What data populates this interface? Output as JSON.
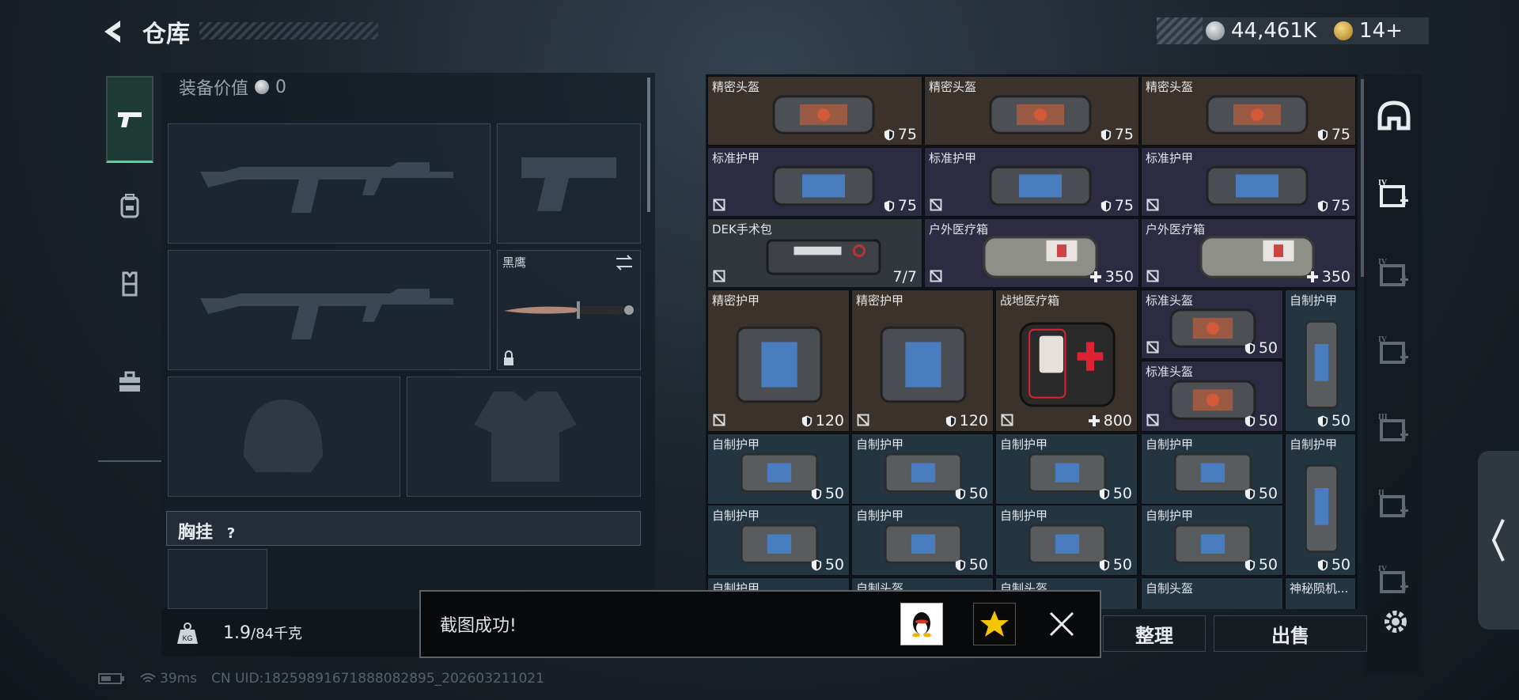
{
  "header": {
    "title": "仓库",
    "currency_silver": "44,461K",
    "currency_gold": "14+"
  },
  "equipment": {
    "value_label": "装备价值",
    "value": "0",
    "melee_name": "黑鹰",
    "chest_label": "胸挂",
    "chest_help": "?"
  },
  "footer": {
    "weight_current": "1.9",
    "weight_max": "/84千克",
    "sort_label": "整理",
    "sell_label": "出售",
    "ping": "39ms",
    "uid": "CN UID:1825989167188808289​5_202603211021"
  },
  "toast": {
    "message": "截图成功!"
  },
  "inventory": [
    {
      "name": "精密头盔",
      "value": "75",
      "kind": "shield",
      "color": "brown",
      "img": "helmet-red"
    },
    {
      "name": "精密头盔",
      "value": "75",
      "kind": "shield",
      "color": "brown",
      "img": "helmet-red"
    },
    {
      "name": "精密头盔",
      "value": "75",
      "kind": "shield",
      "color": "brown",
      "img": "helmet-red"
    },
    {
      "name": "标准护甲",
      "value": "75",
      "kind": "shield",
      "color": "purple",
      "img": "armor-blue"
    },
    {
      "name": "标准护甲",
      "value": "75",
      "kind": "shield",
      "color": "purple",
      "img": "armor-blue"
    },
    {
      "name": "标准护甲",
      "value": "75",
      "kind": "shield",
      "color": "purple",
      "img": "armor-blue"
    },
    {
      "name": "DEK手术包",
      "value": "7/7",
      "kind": "none",
      "color": "grey",
      "img": "surgery-kit"
    },
    {
      "name": "户外医疗箱",
      "value": "350",
      "kind": "plus",
      "color": "purple",
      "img": "med-box"
    },
    {
      "name": "户外医疗箱",
      "value": "350",
      "kind": "plus",
      "color": "purple",
      "img": "med-box"
    },
    {
      "name": "精密护甲",
      "value": "120",
      "kind": "shield",
      "color": "brown",
      "img": "armor-blue-big"
    },
    {
      "name": "精密护甲",
      "value": "120",
      "kind": "shield",
      "color": "brown",
      "img": "armor-blue-big"
    },
    {
      "name": "战地医疗箱",
      "value": "800",
      "kind": "plus",
      "color": "brown",
      "img": "first-aid"
    },
    {
      "name": "标准头盔",
      "value": "50",
      "kind": "shield",
      "color": "purple",
      "img": "helmet-red"
    },
    {
      "name": "标准头盔",
      "value": "50",
      "kind": "shield",
      "color": "purple",
      "img": "helmet-red"
    },
    {
      "name": "自制护甲",
      "value": "50",
      "kind": "shield",
      "color": "blue",
      "img": "vest"
    },
    {
      "name": "自制护甲",
      "value": "50",
      "kind": "shield",
      "color": "blue",
      "img": "pouch"
    },
    {
      "name": "自制护甲",
      "value": "50",
      "kind": "shield",
      "color": "blue",
      "img": "pouch"
    },
    {
      "name": "自制护甲",
      "value": "50",
      "kind": "shield",
      "color": "blue",
      "img": "pouch"
    },
    {
      "name": "自制护甲",
      "value": "50",
      "kind": "shield",
      "color": "blue",
      "img": "pouch"
    },
    {
      "name": "自制护甲",
      "value": "50",
      "kind": "shield",
      "color": "blue",
      "img": "vest"
    },
    {
      "name": "自制护甲",
      "value": "50",
      "kind": "shield",
      "color": "blue",
      "img": "pouch"
    },
    {
      "name": "自制护甲",
      "value": "50",
      "kind": "shield",
      "color": "blue",
      "img": "pouch"
    },
    {
      "name": "自制护甲",
      "value": "50",
      "kind": "shield",
      "color": "blue",
      "img": "pouch"
    },
    {
      "name": "自制护甲",
      "value": "50",
      "kind": "shield",
      "color": "blue",
      "img": "pouch"
    },
    {
      "name": "自制护甲",
      "value": "",
      "kind": "none",
      "color": "blue",
      "img": ""
    },
    {
      "name": "自制头盔",
      "value": "",
      "kind": "none",
      "color": "blue",
      "img": ""
    },
    {
      "name": "自制头盔",
      "value": "",
      "kind": "none",
      "color": "blue",
      "img": ""
    },
    {
      "name": "自制头盔",
      "value": "",
      "kind": "none",
      "color": "blue",
      "img": ""
    },
    {
      "name": "神秘陨机...",
      "value": "",
      "kind": "none",
      "color": "blue",
      "img": ""
    }
  ],
  "right_tabs": [
    "helmet-tab-icon",
    "armor-iv-tab-icon",
    "armor-iv-alt-tab-icon",
    "iv-folder-tab-icon",
    "iii-tab-icon",
    "ii-tab-icon",
    "iv-bottom-tab-icon"
  ]
}
